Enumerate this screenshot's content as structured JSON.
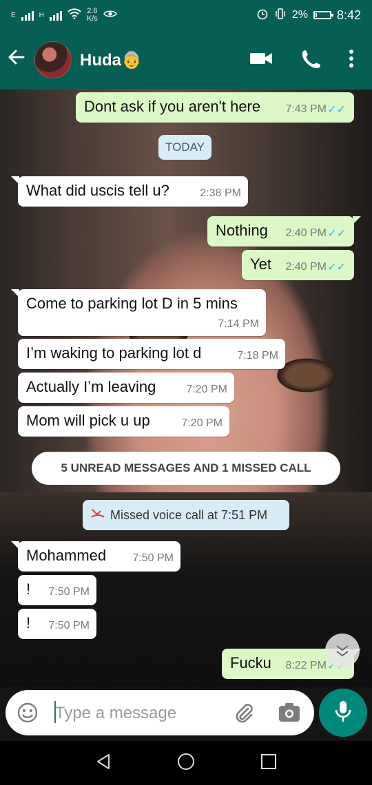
{
  "status_bar": {
    "network_label": "E",
    "network_label2": "H",
    "speed_value": "2.6",
    "speed_unit": "K/s",
    "battery": "2%",
    "time": "8:42"
  },
  "header": {
    "contact_name": "Huda👵"
  },
  "messages": [
    {
      "text": "Dont ask if you aren't here",
      "time": "7:43 PM",
      "dir": "out"
    },
    {
      "text": "What did uscis tell u?",
      "time": "2:38 PM",
      "dir": "in"
    },
    {
      "text": "Nothing",
      "time": "2:40 PM",
      "dir": "out"
    },
    {
      "text": "Yet",
      "time": "2:40 PM",
      "dir": "out"
    },
    {
      "text": "Come to parking lot D in 5 mins",
      "time": "7:14 PM",
      "dir": "in"
    },
    {
      "text": "I’m waking to parking lot d",
      "time": "7:18 PM",
      "dir": "in"
    },
    {
      "text": "Actually I’m leaving",
      "time": "7:20 PM",
      "dir": "in"
    },
    {
      "text": "Mom will pick u up",
      "time": "7:20 PM",
      "dir": "in"
    },
    {
      "text": "Mohammed",
      "time": "7:50 PM",
      "dir": "in"
    },
    {
      "text": "!",
      "time": "7:50 PM",
      "dir": "in"
    },
    {
      "text": "!",
      "time": "7:50 PM",
      "dir": "in"
    },
    {
      "text": "Fucku",
      "time": "8:22 PM",
      "dir": "out"
    }
  ],
  "date_chip": "TODAY",
  "unread_banner": "5 UNREAD MESSAGES AND 1 MISSED CALL",
  "missed_call": "Missed voice call at 7:51 PM",
  "input": {
    "placeholder": "Type a message"
  },
  "colors": {
    "header_bg": "#075e54",
    "outgoing_bubble": "#dcf8c6",
    "incoming_bubble": "#ffffff",
    "mic_button": "#00897b",
    "read_tick": "#34b7f1"
  }
}
